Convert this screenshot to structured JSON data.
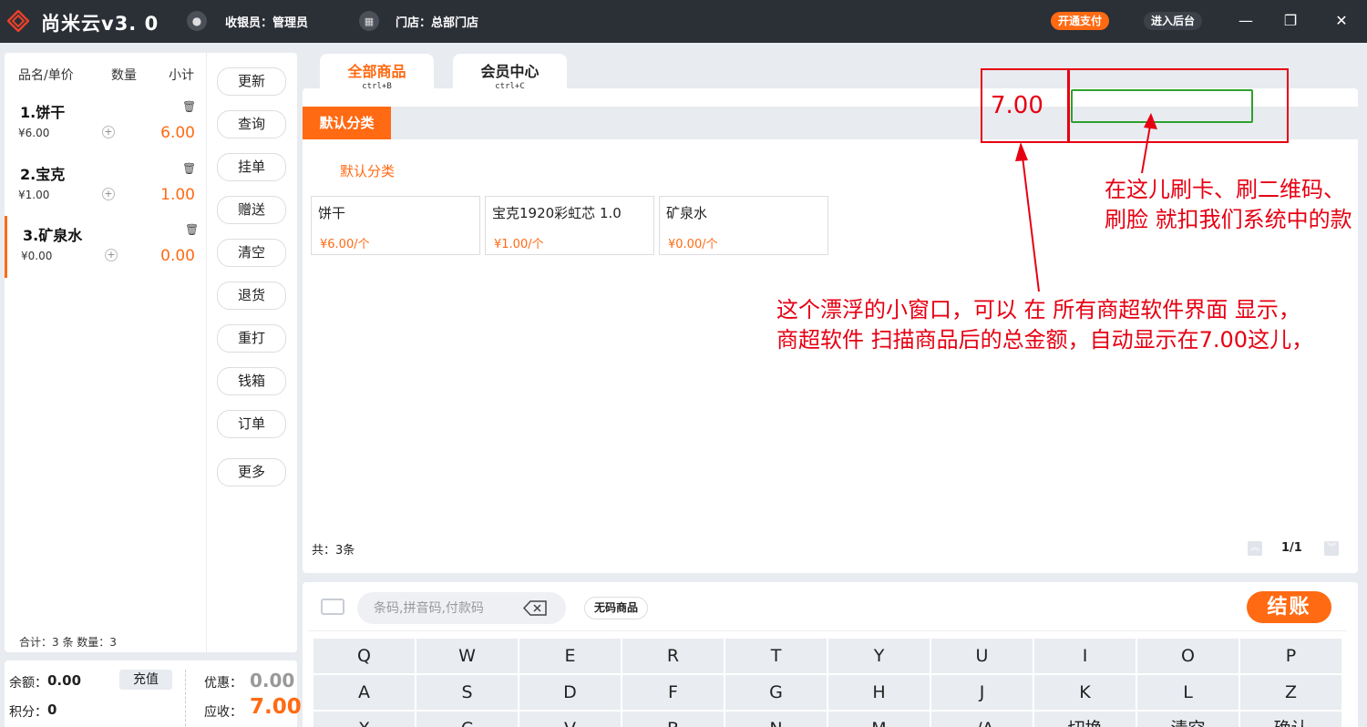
{
  "titlebar": {
    "app_title": "尚米云v3. 0",
    "cashier": "收银员：管理员",
    "store": "门店：总部门店",
    "pay_button": "开通支付",
    "backend_button": "进入后台",
    "minimize": "—",
    "maximize": "❐",
    "close": "✕"
  },
  "cart": {
    "headers": {
      "name": "品名/单价",
      "qty": "数量",
      "subtotal": "小计"
    },
    "items": [
      {
        "name": "1.饼干",
        "price": "¥6.00",
        "subtotal": "6.00"
      },
      {
        "name": "2.宝克",
        "price": "¥1.00",
        "subtotal": "1.00"
      },
      {
        "name": "3.矿泉水",
        "price": "¥0.00",
        "subtotal": "0.00"
      }
    ],
    "total": "合计：3 条  数量：3"
  },
  "side_buttons": [
    "更新",
    "查询",
    "挂单",
    "赠送",
    "清空",
    "退货",
    "重打",
    "钱箱",
    "订单",
    "更多"
  ],
  "balance": {
    "balance_label": "余额：",
    "balance_value": "0.00",
    "recharge": "充值",
    "points_label": "积分：",
    "points_value": "0",
    "discount_label": "优惠：",
    "discount_value": "0.00",
    "due_label": "应收：",
    "due_value": "7.00"
  },
  "tabs": [
    {
      "label": "全部商品",
      "shortcut": "ctrl+B"
    },
    {
      "label": "会员中心",
      "shortcut": "ctrl+C"
    }
  ],
  "category": {
    "active": "默认分类",
    "sub": "默认分类"
  },
  "products": [
    {
      "name": "饼干",
      "price": "¥6.00/个"
    },
    {
      "name": "宝克1920彩虹芯 1.0",
      "price": "¥1.00/个"
    },
    {
      "name": "矿泉水",
      "price": "¥0.00/个"
    }
  ],
  "pagination": {
    "count": "共：3条",
    "page": "1/1"
  },
  "annotation": {
    "amount": "7.00",
    "text1": "在这儿刷卡、刷二维码、刷脸 就扣我们系统中的款",
    "text2": "这个漂浮的小窗口，可以 在 所有商超软件界面  显示，商超软件 扫描商品后的总金额，自动显示在7.00这儿，"
  },
  "bottom": {
    "search_placeholder": "条码,拼音码,付款码",
    "nocode_button": "无码商品",
    "checkout_button": "结账"
  },
  "keyboard": {
    "row1": [
      "Q",
      "W",
      "E",
      "R",
      "T",
      "Y",
      "U",
      "I",
      "O",
      "P"
    ],
    "row2": [
      "A",
      "S",
      "D",
      "F",
      "G",
      "H",
      "J",
      "K",
      "L",
      "Z"
    ],
    "row3": [
      "X",
      "C",
      "V",
      "B",
      "N",
      "M",
      "-/A",
      "切换",
      "清空",
      "确认"
    ]
  },
  "colors": {
    "accent": "#ff6a13",
    "titlebar": "#2b2f36",
    "annotation_red": "#e60012",
    "annotation_green": "#2ea02e"
  }
}
